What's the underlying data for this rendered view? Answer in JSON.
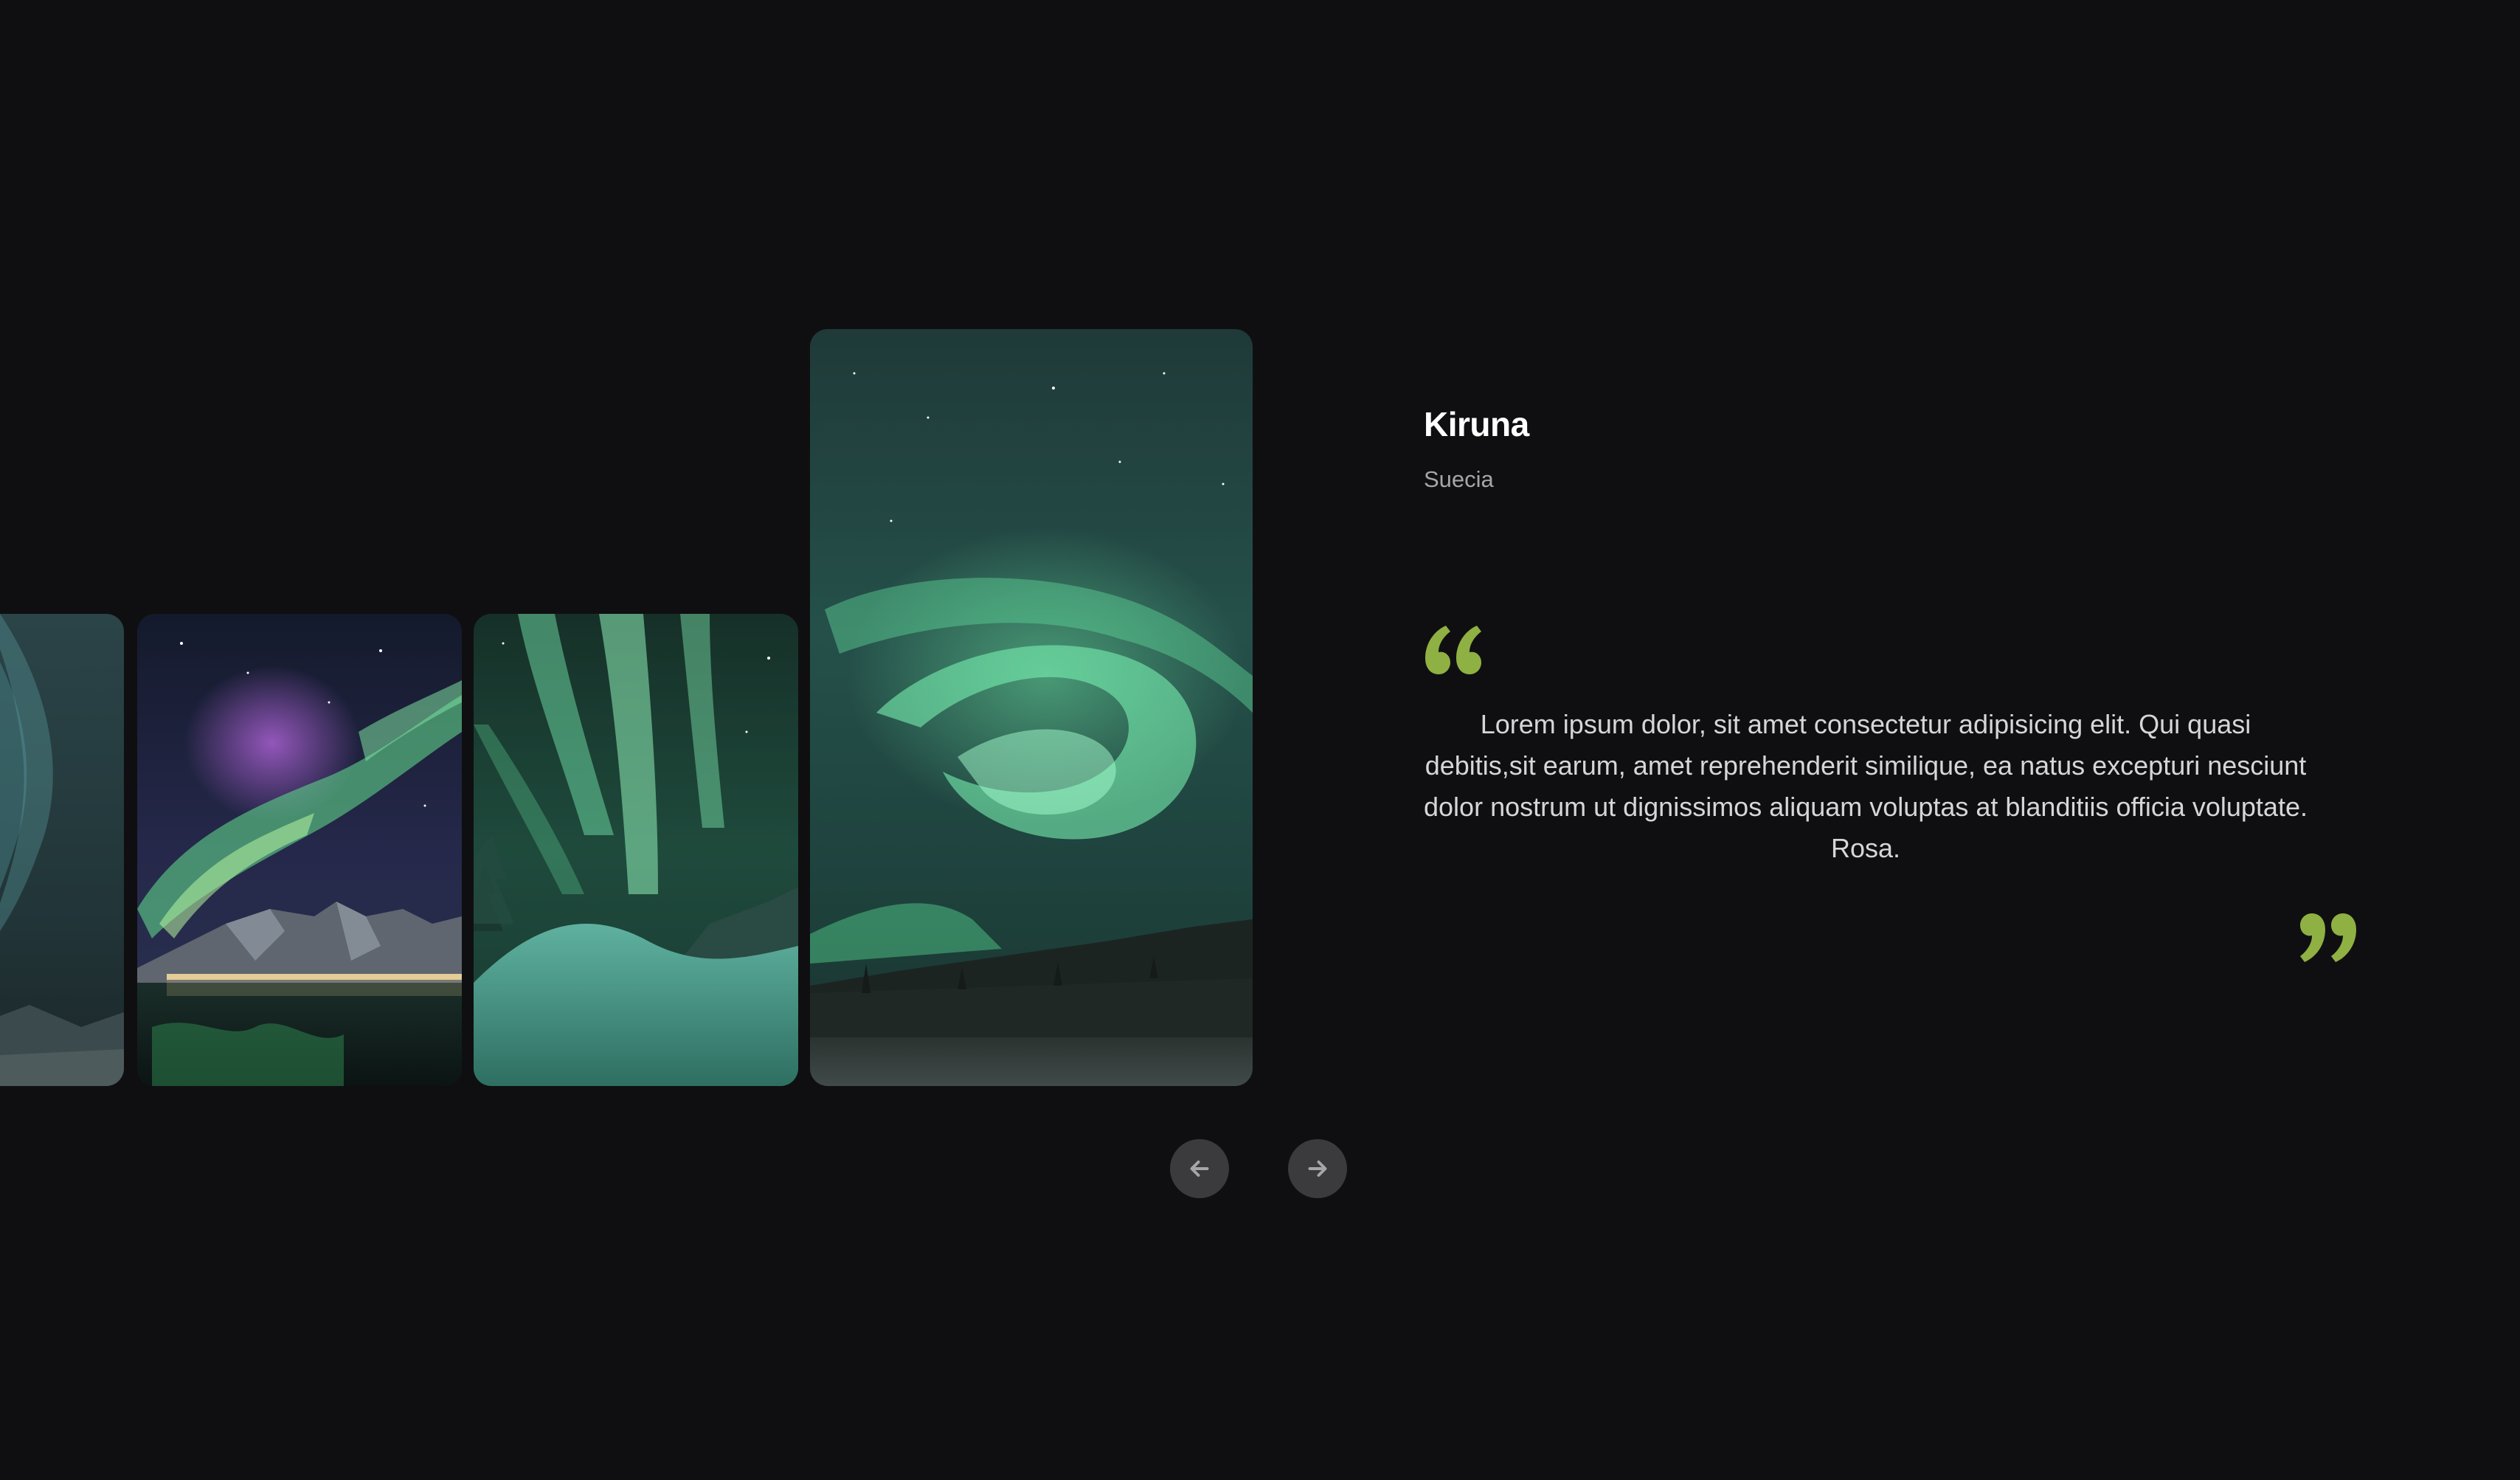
{
  "carousel": {
    "cards": [
      {
        "name": "aurora-photo-partial"
      },
      {
        "name": "aurora-photo-mountains-lake"
      },
      {
        "name": "aurora-photo-snow-trees"
      },
      {
        "name": "aurora-photo-kiruna"
      }
    ],
    "prev_icon": "arrow-left-icon",
    "next_icon": "arrow-right-icon"
  },
  "location": {
    "title": "Kiruna",
    "subtitle": "Suecia"
  },
  "quote": {
    "text": "Lorem ipsum dolor, sit amet consectetur adipisicing elit. Qui quasi debitis,sit earum, amet reprehenderit similique, ea natus excepturi nesciunt dolor nostrum ut dignissimos aliquam voluptas at blanditiis officia voluptate. Rosa.",
    "open_icon": "quote-open-icon",
    "close_icon": "quote-close-icon"
  },
  "colors": {
    "background": "#0f0f11",
    "accent": "#8fb043",
    "button": "#3b3b3e"
  }
}
